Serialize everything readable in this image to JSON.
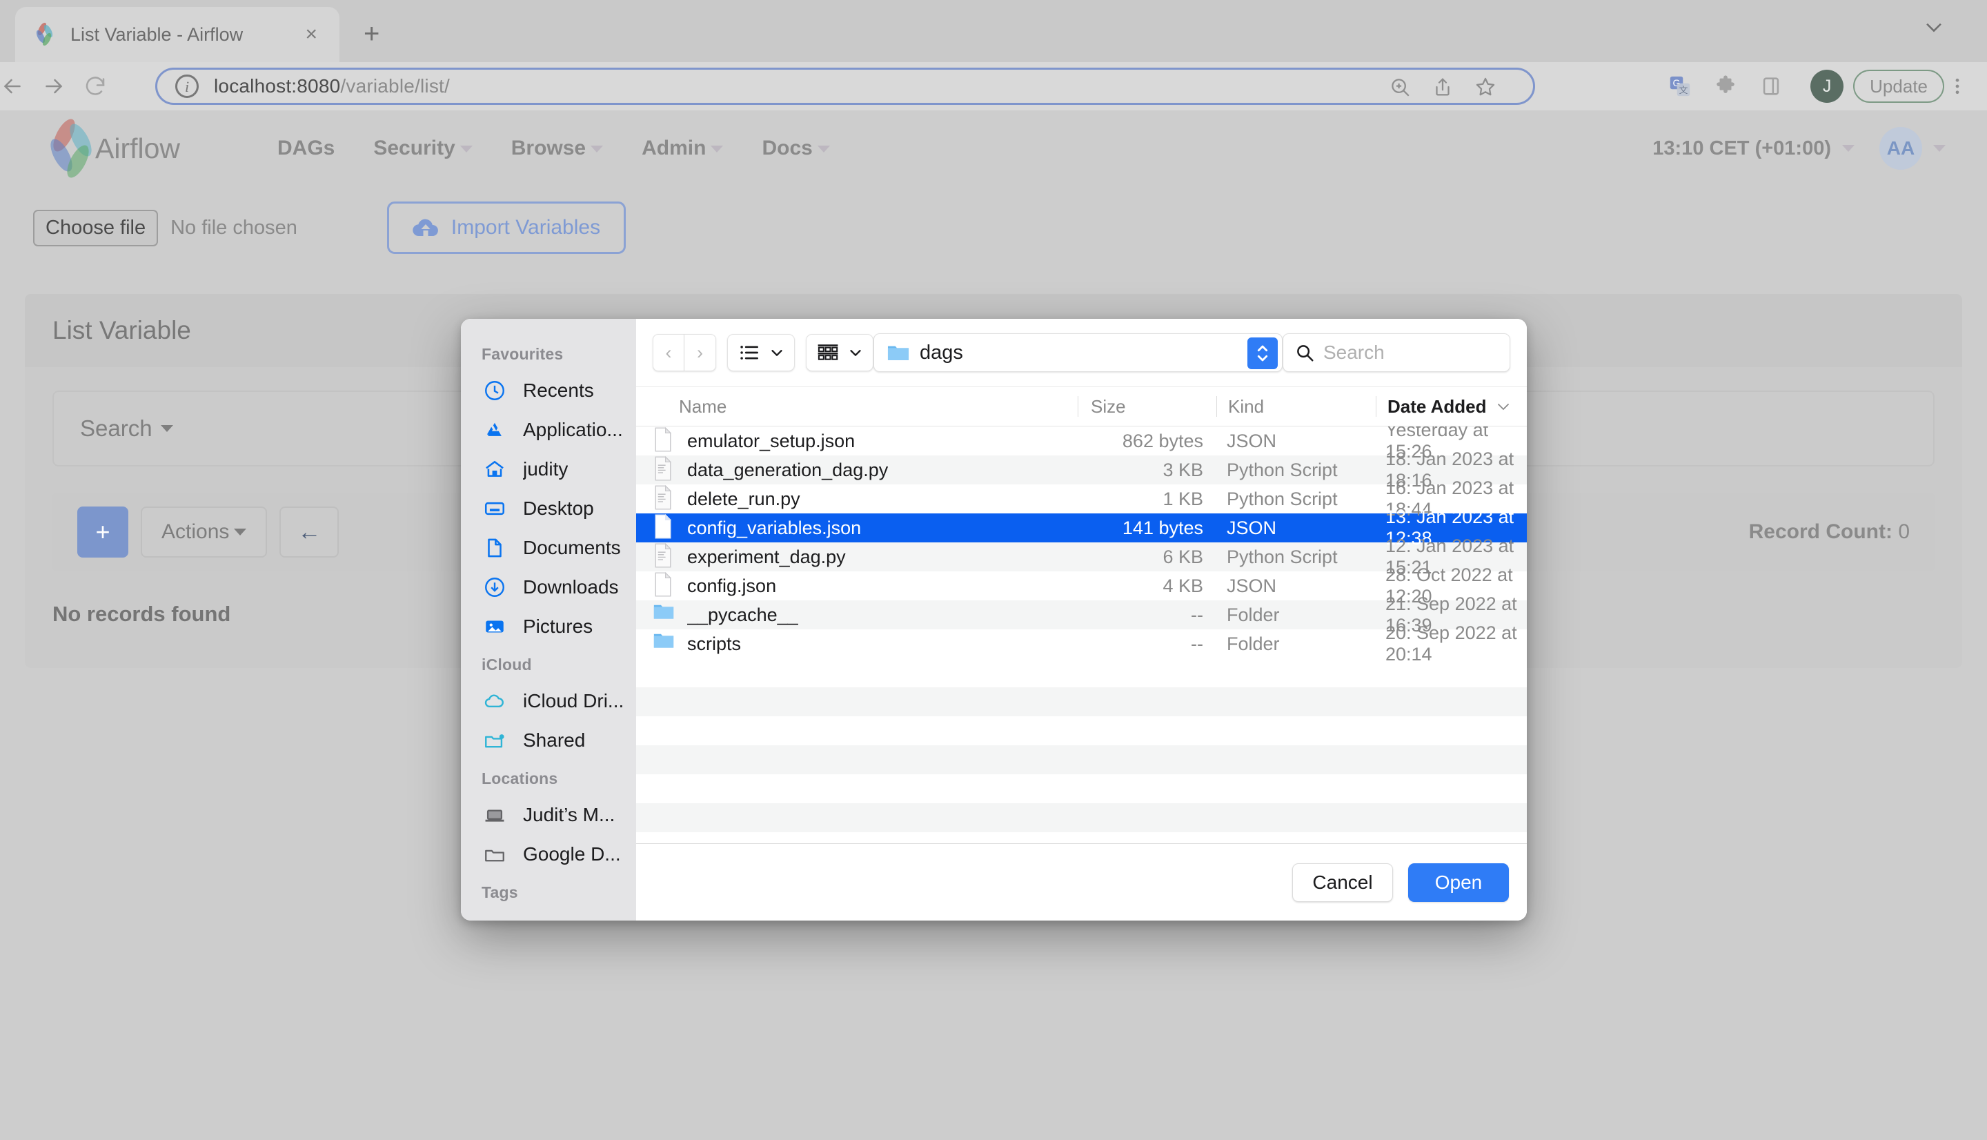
{
  "browser": {
    "tab_title": "List Variable - Airflow",
    "tab_close": "×",
    "new_tab": "+",
    "url_main": "localhost:8080",
    "url_path": "/variable/list/",
    "update_label": "Update",
    "profile_initial": "J"
  },
  "airflow": {
    "brand": "Airflow",
    "nav": [
      {
        "label": "DAGs",
        "caret": false
      },
      {
        "label": "Security",
        "caret": true
      },
      {
        "label": "Browse",
        "caret": true
      },
      {
        "label": "Admin",
        "caret": true
      },
      {
        "label": "Docs",
        "caret": true
      }
    ],
    "time": "13:10 CET (+01:00)",
    "user_initials": "AA",
    "import": {
      "choose_file": "Choose file",
      "no_file": "No file chosen",
      "import_button": "Import Variables"
    },
    "list": {
      "title": "List Variable",
      "search_label": "Search",
      "add_label": "+",
      "actions_label": "Actions",
      "back_label": "←",
      "record_count_label": "Record Count:",
      "record_count_value": "0",
      "empty_text": "No records found"
    }
  },
  "filedialog": {
    "sidebar": {
      "groups": [
        {
          "title": "Favourites",
          "items": [
            {
              "label": "Recents",
              "icon": "clock-icon"
            },
            {
              "label": "Applicatio...",
              "icon": "applications-icon"
            },
            {
              "label": "judity",
              "icon": "home-icon"
            },
            {
              "label": "Desktop",
              "icon": "desktop-icon"
            },
            {
              "label": "Documents",
              "icon": "document-icon"
            },
            {
              "label": "Downloads",
              "icon": "download-icon"
            },
            {
              "label": "Pictures",
              "icon": "pictures-icon"
            }
          ]
        },
        {
          "title": "iCloud",
          "items": [
            {
              "label": "iCloud Dri...",
              "icon": "cloud-icon"
            },
            {
              "label": "Shared",
              "icon": "shared-folder-icon"
            }
          ]
        },
        {
          "title": "Locations",
          "items": [
            {
              "label": "Judit’s M...",
              "icon": "laptop-icon"
            },
            {
              "label": "Google D...",
              "icon": "folder-icon"
            }
          ]
        },
        {
          "title": "Tags",
          "items": []
        }
      ]
    },
    "toolbar": {
      "back": "‹",
      "forward": "›",
      "current_folder": "dags",
      "search_placeholder": "Search"
    },
    "columns": {
      "name": "Name",
      "size": "Size",
      "kind": "Kind",
      "date_added": "Date Added"
    },
    "files": [
      {
        "name": "emulator_setup.json",
        "size": "862 bytes",
        "kind": "JSON",
        "date": "Yesterday at 15:26",
        "icon": "json-file-icon",
        "selected": false
      },
      {
        "name": "data_generation_dag.py",
        "size": "3 KB",
        "kind": "Python Script",
        "date": "18. Jan 2023 at 18:16",
        "icon": "python-file-icon",
        "selected": false
      },
      {
        "name": "delete_run.py",
        "size": "1 KB",
        "kind": "Python Script",
        "date": "16. Jan 2023 at 18:44",
        "icon": "python-file-icon",
        "selected": false
      },
      {
        "name": "config_variables.json",
        "size": "141 bytes",
        "kind": "JSON",
        "date": "13. Jan 2023 at 12:38",
        "icon": "json-file-icon",
        "selected": true
      },
      {
        "name": "experiment_dag.py",
        "size": "6 KB",
        "kind": "Python Script",
        "date": "12. Jan 2023 at 15:21",
        "icon": "python-file-icon",
        "selected": false
      },
      {
        "name": "config.json",
        "size": "4 KB",
        "kind": "JSON",
        "date": "28. Oct 2022 at 12:20",
        "icon": "json-file-icon",
        "selected": false
      },
      {
        "name": "__pycache__",
        "size": "--",
        "kind": "Folder",
        "date": "21. Sep 2022 at 16:39",
        "icon": "folder-icon",
        "selected": false
      },
      {
        "name": "scripts",
        "size": "--",
        "kind": "Folder",
        "date": "20. Sep 2022 at 20:14",
        "icon": "folder-icon",
        "selected": false
      }
    ],
    "footer": {
      "cancel": "Cancel",
      "open": "Open"
    }
  },
  "colors": {
    "selection_blue": "#0a5ff0",
    "accent_blue": "#2f7cf6",
    "page_bg": "#cdcdcd"
  }
}
